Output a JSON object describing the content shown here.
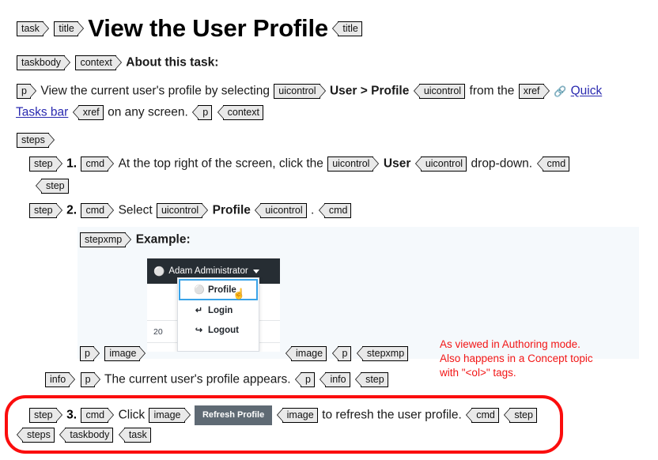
{
  "document": {
    "title_text": "View the User Profile",
    "tags": {
      "task": "task",
      "title": "title",
      "taskbody": "taskbody",
      "context": "context",
      "p": "p",
      "uicontrol": "uicontrol",
      "xref": "xref",
      "steps": "steps",
      "step": "step",
      "cmd": "cmd",
      "stepxmp": "stepxmp",
      "image": "image",
      "info": "info"
    }
  },
  "context_section": {
    "heading": "About this task:",
    "sentence_part1": "View the current user's profile by selecting ",
    "uicontrol_menupath": "User > Profile",
    "sentence_part2": " from the ",
    "link_icon": "link-icon",
    "xref_text_line1": "Quick",
    "xref_text_line2": "Tasks bar",
    "sentence_part3": " on any screen."
  },
  "steps": [
    {
      "number": "1.",
      "text_before": "At the top right of the screen, click the ",
      "uicontrol": "User",
      "text_after": " drop-down."
    },
    {
      "number": "2.",
      "text_before": "Select ",
      "uicontrol": "Profile",
      "text_after": "."
    },
    {
      "number": "3.",
      "text_before": "Click ",
      "image_label": "Refresh Profile",
      "text_after": " to refresh the user profile."
    }
  ],
  "example": {
    "heading": "Example:",
    "screenshot": {
      "user_icon": "user-icon",
      "user_name": "Adam Administrator",
      "caret_icon": "chevron-down-icon",
      "table_cell_value": "20",
      "menu_items": [
        {
          "icon": "user-icon",
          "label": "Profile",
          "glyph": "⚲"
        },
        {
          "icon": "login-icon",
          "label": "Login",
          "glyph": "↩"
        },
        {
          "icon": "logout-icon",
          "label": "Logout",
          "glyph": "↪"
        }
      ],
      "cursor_icon": "hand-pointer-cursor"
    }
  },
  "info_section": {
    "text": "The current user's profile appears."
  },
  "annotation": {
    "line1": "As viewed in Authoring mode.",
    "line2": "Also happens in a Concept topic",
    "line3": "with \"<ol>\" tags.",
    "color": "#f21616"
  },
  "colors": {
    "tag_fill": "#e9e9e9",
    "tag_border": "#000000",
    "annotation_red": "#f21616",
    "highlight_red": "#fb0d0d",
    "example_bg": "#f5f9fc",
    "mock_header_bg": "#262d33",
    "menu_highlight_border": "#39a3e8",
    "button_bg": "#5f6a74",
    "link_blue": "#2a2ab0"
  }
}
